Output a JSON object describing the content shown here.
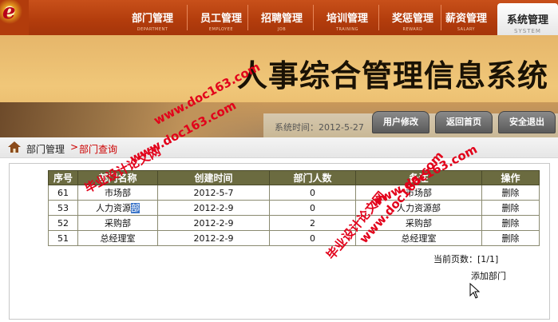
{
  "nav": {
    "items": [
      {
        "label": "部门管理",
        "sub": "DEPARTMENT"
      },
      {
        "label": "员工管理",
        "sub": "EMPLOYEE"
      },
      {
        "label": "招聘管理",
        "sub": "JOB"
      },
      {
        "label": "培训管理",
        "sub": "TRAINING"
      },
      {
        "label": "奖惩管理",
        "sub": "REWARD"
      },
      {
        "label": "薪资管理",
        "sub": "SALARY"
      }
    ],
    "active": {
      "label": "系统管理",
      "sub": "SYSTEM"
    }
  },
  "banner": {
    "title": "人事综合管理信息系统",
    "time_label": "系统时间：2012-5-27",
    "buttons": [
      "用户修改",
      "返回首页",
      "安全退出"
    ]
  },
  "breadcrumb": {
    "root": "部门管理",
    "arrow": ">",
    "current": "部门查询"
  },
  "table": {
    "headers": [
      "序号",
      "部门名称",
      "创建时间",
      "部门人数",
      "备注",
      "操作"
    ],
    "rows": [
      {
        "id": "61",
        "name": "市场部",
        "date": "2012-5-7",
        "count": "0",
        "note": "市场部",
        "op": "删除"
      },
      {
        "id": "53",
        "name_a": "人力资源",
        "name_b": "部",
        "date": "2012-2-9",
        "count": "0",
        "note": "人力资源部",
        "op": "删除"
      },
      {
        "id": "52",
        "name": "采购部",
        "date": "2012-2-9",
        "count": "2",
        "note": "采购部",
        "op": "删除"
      },
      {
        "id": "51",
        "name": "总经理室",
        "date": "2012-2-9",
        "count": "0",
        "note": "总经理室",
        "op": "删除"
      }
    ]
  },
  "pagination": {
    "text": "当前页数：[1/1]"
  },
  "add_link": "添加部门",
  "watermarks": {
    "site_cn": "毕业设计论文网",
    "site_url": "www.doc163.com"
  },
  "colors": {
    "nav_bg": "#b23c0c",
    "table_header": "#6b6b40",
    "crumb_active": "#cc0000",
    "watermark": "#e2001a"
  }
}
